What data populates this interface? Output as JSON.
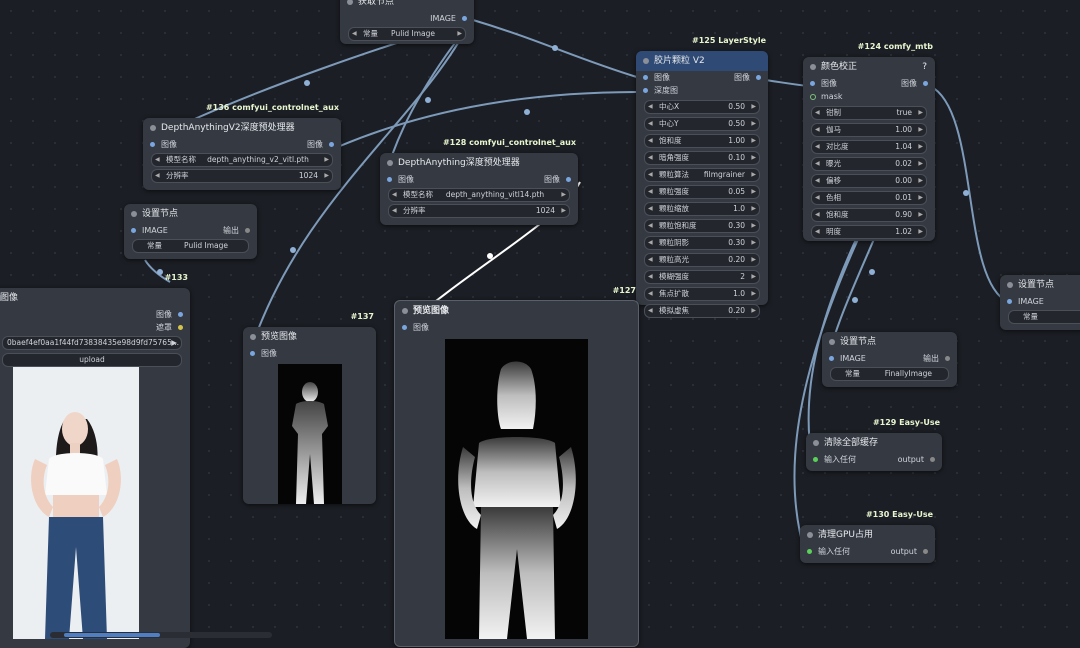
{
  "get_node": {
    "title": "获取节点",
    "out": "IMAGE",
    "widget_label": "常量",
    "widget_value": "Pulid Image"
  },
  "n136": {
    "badge": "#136 comfyui_controlnet_aux",
    "title": "DepthAnythingV2深度预处理器",
    "in": "图像",
    "out": "图像",
    "widgets": [
      {
        "label": "模型名称",
        "value": "depth_anything_v2_vitl.pth"
      },
      {
        "label": "分辨率",
        "value": "1024"
      }
    ]
  },
  "n128": {
    "badge": "#128 comfyui_controlnet_aux",
    "title": "DepthAnything深度预处理器",
    "in": "图像",
    "out": "图像",
    "widgets": [
      {
        "label": "模型名称",
        "value": "depth_anything_vitl14.pth"
      },
      {
        "label": "分辨率",
        "value": "1024"
      }
    ]
  },
  "n125": {
    "badge": "#125 LayerStyle",
    "title": "胶片颗粒 V2",
    "in1": "图像",
    "in2": "深度图",
    "out": "图像",
    "widgets": [
      {
        "label": "中心X",
        "value": "0.50"
      },
      {
        "label": "中心Y",
        "value": "0.50"
      },
      {
        "label": "饱和度",
        "value": "1.00"
      },
      {
        "label": "暗角强度",
        "value": "0.10"
      },
      {
        "label": "颗粒算法",
        "value": "filmgrainer"
      },
      {
        "label": "颗粒强度",
        "value": "0.05"
      },
      {
        "label": "颗粒缩放",
        "value": "1.0"
      },
      {
        "label": "颗粒饱和度",
        "value": "0.30"
      },
      {
        "label": "颗粒阴影",
        "value": "0.30"
      },
      {
        "label": "颗粒高光",
        "value": "0.20"
      },
      {
        "label": "模糊强度",
        "value": "2"
      },
      {
        "label": "焦点扩散",
        "value": "1.0"
      },
      {
        "label": "模拟虚焦",
        "value": "0.20"
      }
    ]
  },
  "n124": {
    "badge": "#124 comfy_mtb",
    "title": "颜色校正",
    "help": "?",
    "in1": "图像",
    "in2": "mask",
    "out": "图像",
    "widgets": [
      {
        "label": "钳制",
        "value": "true"
      },
      {
        "label": "伽马",
        "value": "1.00"
      },
      {
        "label": "对比度",
        "value": "1.04"
      },
      {
        "label": "曝光",
        "value": "0.02"
      },
      {
        "label": "偏移",
        "value": "0.00"
      },
      {
        "label": "色相",
        "value": "0.01"
      },
      {
        "label": "饱和度",
        "value": "0.90"
      },
      {
        "label": "明度",
        "value": "1.02"
      }
    ]
  },
  "set_left": {
    "title": "设置节点",
    "in": "IMAGE",
    "out": "输出",
    "widget_label": "常量",
    "widget_value": "Pulid Image"
  },
  "set_mid": {
    "title": "设置节点",
    "in": "IMAGE",
    "out": "输出",
    "widget_label": "常量",
    "widget_value": "FinallyImage"
  },
  "set_right": {
    "title": "设置节点",
    "in": "IMAGE",
    "widget_label": "常量"
  },
  "n133": {
    "badge": "#133",
    "title": "图像",
    "out1": "图像",
    "out2": "遮罩",
    "file": "0baef4ef0aa1f44fd73838435e98d9fd75765...",
    "upload": "upload"
  },
  "n137": {
    "badge": "#137",
    "title": "预览图像",
    "in": "图像"
  },
  "n127": {
    "badge": "#127",
    "title": "预览图像",
    "in": "图像"
  },
  "n129": {
    "badge": "#129 Easy-Use",
    "title": "清除全部缓存",
    "in": "输入任何",
    "out": "output"
  },
  "n130": {
    "badge": "#130 Easy-Use",
    "title": "清理GPU占用",
    "in": "输入任何",
    "out": "output"
  }
}
